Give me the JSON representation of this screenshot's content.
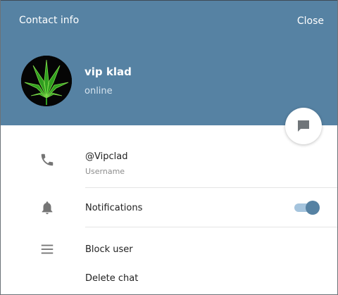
{
  "header": {
    "title": "Contact info",
    "close_label": "Close",
    "background_color": "#5682a3"
  },
  "contact": {
    "name": "vip klad",
    "status": "online",
    "avatar_icon": "cannabis-leaf-avatar"
  },
  "message_button": {
    "icon": "chat-bubble-icon"
  },
  "info": {
    "username": "@Vipclad",
    "username_caption": "Username",
    "notifications_label": "Notifications",
    "notifications_enabled": true,
    "accent_color": "#5682a3"
  },
  "actions": {
    "block_user": "Block user",
    "delete_chat": "Delete chat"
  },
  "icons": {
    "username_row": "phone-icon",
    "notifications_row": "bell-icon",
    "actions_row": "menu-icon"
  }
}
